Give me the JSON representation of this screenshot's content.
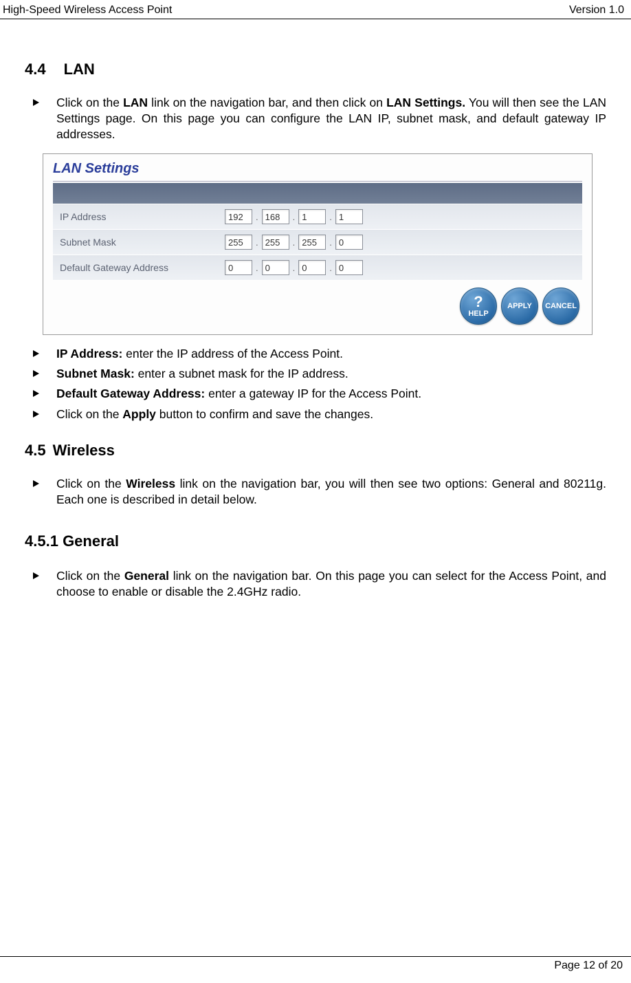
{
  "header": {
    "title": "High-Speed Wireless Access Point",
    "version": "Version 1.0"
  },
  "sections": {
    "s44": {
      "number": "4.4",
      "title": "LAN"
    },
    "s45": {
      "number": "4.5",
      "title": "Wireless"
    },
    "s451": {
      "number": "4.5.1",
      "title": "General"
    }
  },
  "bullets": {
    "lan_intro_pre": "Click on the ",
    "lan_intro_b1": "LAN",
    "lan_intro_mid": " link on the navigation bar, and then click on ",
    "lan_intro_b2": "LAN Settings.",
    "lan_intro_post": " You will then see the LAN Settings page. On this page you can configure the LAN IP, subnet mask, and default gateway IP addresses.",
    "ip_label": "IP Address:",
    "ip_text": " enter the IP address of the Access Point.",
    "subnet_label": "Subnet Mask:",
    "subnet_text": " enter a subnet mask for the IP address.",
    "gateway_label": "Default Gateway Address:",
    "gateway_text": " enter a gateway IP for the Access Point.",
    "apply_pre": "Click on the ",
    "apply_b": "Apply",
    "apply_post": " button to confirm and save the changes.",
    "wireless_pre": "Click on the ",
    "wireless_b": "Wireless",
    "wireless_post": " link on the navigation bar, you will then see two options: General and 80211g. Each one is described in detail below.",
    "general_pre": "Click on the ",
    "general_b": "General",
    "general_post": " link on the navigation bar.  On this page you can select for the Access Point, and choose to enable or disable the 2.4GHz radio."
  },
  "panel": {
    "title": "LAN Settings",
    "rows": [
      {
        "label": "IP Address",
        "octets": [
          "192",
          "168",
          "1",
          "1"
        ]
      },
      {
        "label": "Subnet Mask",
        "octets": [
          "255",
          "255",
          "255",
          "0"
        ]
      },
      {
        "label": "Default Gateway Address",
        "octets": [
          "0",
          "0",
          "0",
          "0"
        ]
      }
    ],
    "buttons": {
      "help": "HELP",
      "apply": "APPLY",
      "cancel": "CANCEL"
    }
  },
  "footer": {
    "page": "Page 12 of 20"
  }
}
